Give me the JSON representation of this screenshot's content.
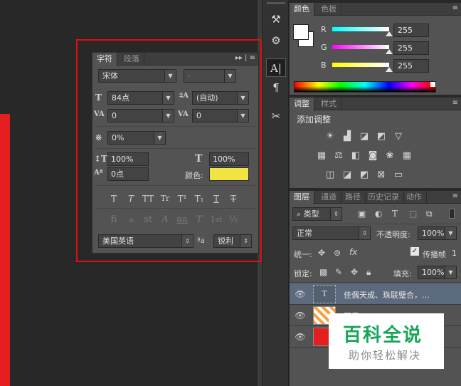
{
  "character_panel": {
    "tabs": [
      "字符",
      "段落"
    ],
    "menu_glyph": "▸▸ | ≡",
    "font_family": "宋体",
    "font_style": "-",
    "font_size": "84点",
    "leading": "(自动)",
    "kerning": "0",
    "tracking": "0",
    "tsume": "0%",
    "vertical_scale": "100%",
    "horizontal_scale": "100%",
    "baseline_shift": "0点",
    "color_label": "颜色:",
    "color_value": "#f0e442",
    "style_buttons": [
      "T",
      "T",
      "TT",
      "Tr",
      "T¹",
      "T₁",
      "T",
      "T"
    ],
    "opentype_buttons": [
      "fi",
      "ℴ",
      "st",
      "A",
      "aa",
      "T",
      "1st",
      "½"
    ],
    "language": "美国英语",
    "aa_label": "ªa",
    "antialias": "锐利"
  },
  "color_panel": {
    "tabs": [
      "颜色",
      "色板"
    ],
    "channels": [
      {
        "name": "R",
        "value": "255"
      },
      {
        "name": "G",
        "value": "255"
      },
      {
        "name": "B",
        "value": "255"
      }
    ]
  },
  "adjustments_panel": {
    "tabs": [
      "调整",
      "样式"
    ],
    "heading": "添加调整"
  },
  "layers_panel": {
    "tabs": [
      "图层",
      "通道",
      "路径",
      "历史记录",
      "动作"
    ],
    "filter_type": "类型",
    "blend_mode": "正常",
    "opacity_label": "不透明度:",
    "opacity": "100%",
    "unify_label": "统一:",
    "propagate_label": "传播帧",
    "propagate_count": "1",
    "lock_label": "锁定:",
    "fill_label": "填充:",
    "fill": "100%",
    "layers": [
      {
        "name": "佳偶天成、珠联璧合，…",
        "type": "text"
      },
      {
        "name": "图层 1",
        "type": "pattern"
      },
      {
        "name": "",
        "type": "red"
      }
    ]
  },
  "watermark": {
    "title": "百科全说",
    "subtitle": "助你轻松解决"
  },
  "colors": {
    "highlight": "#e00f0f",
    "canvas_red": "#e41e1e",
    "text_color_swatch": "#f0e442"
  }
}
